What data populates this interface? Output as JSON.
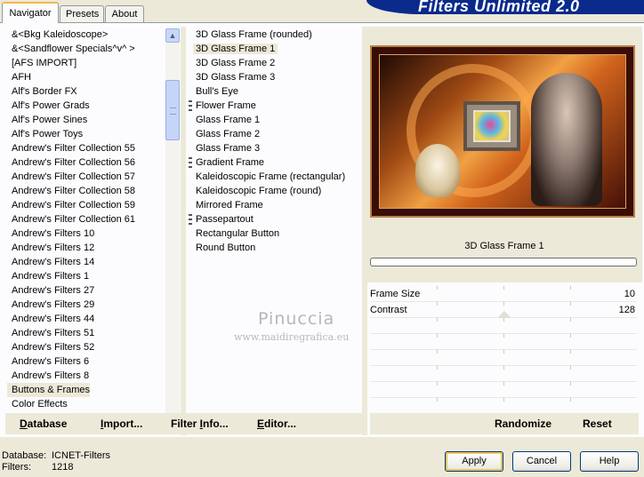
{
  "tabs": [
    {
      "label": "Navigator",
      "active": true
    },
    {
      "label": "Presets",
      "active": false
    },
    {
      "label": "About",
      "active": false
    }
  ],
  "banner_title": "Filters Unlimited 2.0",
  "categories": [
    "&<Bkg Kaleidoscope>",
    "&<Sandflower Specials^v^ >",
    "[AFS IMPORT]",
    "AFH",
    "Alf's Border FX",
    "Alf's Power Grads",
    "Alf's Power Sines",
    "Alf's Power Toys",
    "Andrew's Filter Collection 55",
    "Andrew's Filter Collection 56",
    "Andrew's Filter Collection 57",
    "Andrew's Filter Collection 58",
    "Andrew's Filter Collection 59",
    "Andrew's Filter Collection 61",
    "Andrew's Filters 10",
    "Andrew's Filters 12",
    "Andrew's Filters 14",
    "Andrew's Filters 1",
    "Andrew's Filters 27",
    "Andrew's Filters 29",
    "Andrew's Filters 44",
    "Andrew's Filters 51",
    "Andrew's Filters 52",
    "Andrew's Filters 6",
    "Andrew's Filters 8",
    "Buttons & Frames",
    "Color Effects"
  ],
  "selected_category": "Buttons & Frames",
  "filters": [
    {
      "label": "3D Glass Frame (rounded)",
      "group": false
    },
    {
      "label": "3D Glass Frame 1",
      "group": false
    },
    {
      "label": "3D Glass Frame 2",
      "group": false
    },
    {
      "label": "3D Glass Frame 3",
      "group": false
    },
    {
      "label": "Bull's Eye",
      "group": false
    },
    {
      "label": "Flower Frame",
      "group": true
    },
    {
      "label": "Glass Frame 1",
      "group": false
    },
    {
      "label": "Glass Frame 2",
      "group": false
    },
    {
      "label": "Glass Frame 3",
      "group": false
    },
    {
      "label": "Gradient Frame",
      "group": true
    },
    {
      "label": "Kaleidoscopic Frame (rectangular)",
      "group": false
    },
    {
      "label": "Kaleidoscopic Frame (round)",
      "group": false
    },
    {
      "label": "Mirrored Frame",
      "group": false
    },
    {
      "label": "Passepartout",
      "group": true
    },
    {
      "label": "Rectangular Button",
      "group": false
    },
    {
      "label": "Round Button",
      "group": false
    }
  ],
  "selected_filter": "3D Glass Frame 1",
  "watermark": {
    "name": "Pinuccia",
    "url": "www.maidiregrafica.eu"
  },
  "preview": {
    "filter_name": "3D Glass Frame 1",
    "progress": 0
  },
  "parameters": [
    {
      "label": "Frame Size",
      "value": "10",
      "fraction": 0.039
    },
    {
      "label": "Contrast",
      "value": "128",
      "fraction": 0.502
    }
  ],
  "bottom_left_buttons": {
    "database": {
      "prefix": "",
      "underline": "D",
      "rest": "atabase"
    },
    "import": {
      "prefix": "",
      "underline": "I",
      "rest": "mport..."
    },
    "filter_info": {
      "prefix": "Filter ",
      "underline": "I",
      "rest": "nfo..."
    },
    "editor": {
      "prefix": "",
      "underline": "E",
      "rest": "ditor..."
    }
  },
  "bottom_right_buttons": {
    "randomize": "Randomize",
    "reset": "Reset"
  },
  "footer": {
    "database_label": "Database:",
    "database_value": "ICNET-Filters",
    "filters_label": "Filters:",
    "filters_value": "1218"
  },
  "dialog_buttons": {
    "apply": "Apply",
    "cancel": "Cancel",
    "help": "Help"
  }
}
